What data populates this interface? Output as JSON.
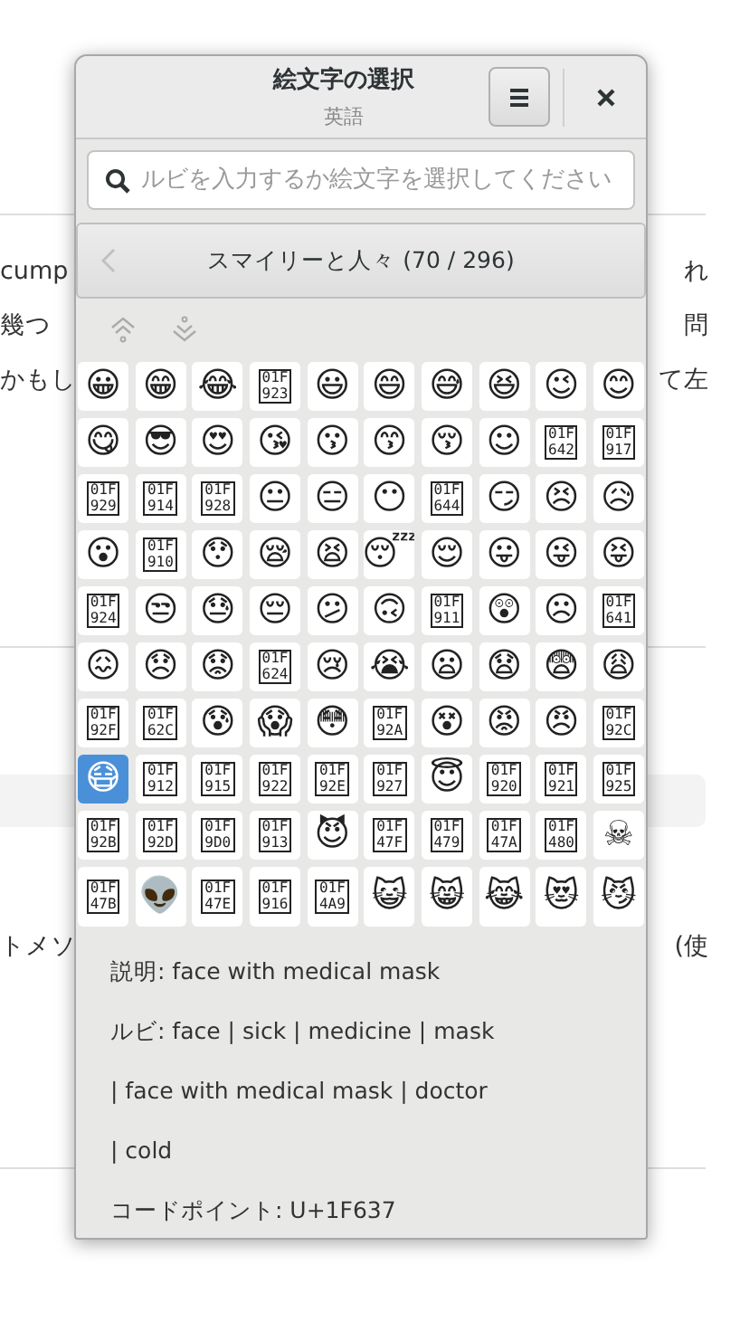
{
  "background_text": {
    "rows_top": [
      {
        "left": "cump",
        "right": "れ"
      },
      {
        "left": "幾つ",
        "right": "問"
      },
      {
        "left": "かもし",
        "right": "て左"
      }
    ],
    "rows_bottom": [
      {
        "left": "トメソ",
        "right": "(使"
      }
    ]
  },
  "window": {
    "title": "絵文字の選択",
    "subtitle": "英語"
  },
  "search": {
    "placeholder": "ルビを入力するか絵文字を選択してください"
  },
  "category": {
    "label": "スマイリーと人々 (70 / 296)",
    "back_disabled": true
  },
  "emojis": [
    {
      "kind": "glyph",
      "text": "😀",
      "selected": false
    },
    {
      "kind": "glyph",
      "text": "😁",
      "selected": false
    },
    {
      "kind": "glyph",
      "text": "😂",
      "selected": false
    },
    {
      "kind": "missing",
      "text": "01F\n923",
      "selected": false
    },
    {
      "kind": "glyph",
      "text": "😃",
      "selected": false
    },
    {
      "kind": "glyph",
      "text": "😄",
      "selected": false
    },
    {
      "kind": "glyph",
      "text": "😅",
      "selected": false
    },
    {
      "kind": "glyph",
      "text": "😆",
      "selected": false
    },
    {
      "kind": "glyph",
      "text": "😉",
      "selected": false
    },
    {
      "kind": "glyph",
      "text": "😊",
      "selected": false
    },
    {
      "kind": "glyph",
      "text": "😋",
      "selected": false
    },
    {
      "kind": "glyph",
      "text": "😎",
      "selected": false
    },
    {
      "kind": "glyph",
      "text": "😍",
      "selected": false
    },
    {
      "kind": "glyph",
      "text": "😘",
      "selected": false
    },
    {
      "kind": "glyph",
      "text": "😗",
      "selected": false
    },
    {
      "kind": "glyph",
      "text": "😙",
      "selected": false
    },
    {
      "kind": "glyph",
      "text": "😚",
      "selected": false
    },
    {
      "kind": "glyph",
      "text": "☺",
      "selected": false
    },
    {
      "kind": "missing",
      "text": "01F\n642",
      "selected": false
    },
    {
      "kind": "missing",
      "text": "01F\n917",
      "selected": false
    },
    {
      "kind": "missing",
      "text": "01F\n929",
      "selected": false
    },
    {
      "kind": "missing",
      "text": "01F\n914",
      "selected": false
    },
    {
      "kind": "missing",
      "text": "01F\n928",
      "selected": false
    },
    {
      "kind": "glyph",
      "text": "😐",
      "selected": false
    },
    {
      "kind": "glyph",
      "text": "😑",
      "selected": false
    },
    {
      "kind": "glyph",
      "text": "😶",
      "selected": false
    },
    {
      "kind": "missing",
      "text": "01F\n644",
      "selected": false
    },
    {
      "kind": "glyph",
      "text": "😏",
      "selected": false
    },
    {
      "kind": "glyph",
      "text": "😣",
      "selected": false
    },
    {
      "kind": "glyph",
      "text": "😥",
      "selected": false
    },
    {
      "kind": "glyph",
      "text": "😮",
      "selected": false
    },
    {
      "kind": "missing",
      "text": "01F\n910",
      "selected": false
    },
    {
      "kind": "glyph",
      "text": "😯",
      "selected": false
    },
    {
      "kind": "glyph",
      "text": "😪",
      "selected": false
    },
    {
      "kind": "glyph",
      "text": "😫",
      "selected": false
    },
    {
      "kind": "glyph",
      "text": "😴",
      "selected": false
    },
    {
      "kind": "glyph",
      "text": "😌",
      "selected": false
    },
    {
      "kind": "glyph",
      "text": "😛",
      "selected": false
    },
    {
      "kind": "glyph",
      "text": "😜",
      "selected": false
    },
    {
      "kind": "glyph",
      "text": "😝",
      "selected": false
    },
    {
      "kind": "missing",
      "text": "01F\n924",
      "selected": false
    },
    {
      "kind": "glyph",
      "text": "😒",
      "selected": false
    },
    {
      "kind": "glyph",
      "text": "😓",
      "selected": false
    },
    {
      "kind": "glyph",
      "text": "😔",
      "selected": false
    },
    {
      "kind": "glyph",
      "text": "😕",
      "selected": false
    },
    {
      "kind": "glyph",
      "text": "🙃",
      "selected": false
    },
    {
      "kind": "missing",
      "text": "01F\n911",
      "selected": false
    },
    {
      "kind": "glyph",
      "text": "😲",
      "selected": false
    },
    {
      "kind": "glyph",
      "text": "☹",
      "selected": false
    },
    {
      "kind": "missing",
      "text": "01F\n641",
      "selected": false
    },
    {
      "kind": "glyph",
      "text": "😖",
      "selected": false
    },
    {
      "kind": "glyph",
      "text": "😞",
      "selected": false
    },
    {
      "kind": "glyph",
      "text": "😟",
      "selected": false
    },
    {
      "kind": "missing",
      "text": "01F\n624",
      "selected": false
    },
    {
      "kind": "glyph",
      "text": "😢",
      "selected": false
    },
    {
      "kind": "glyph",
      "text": "😭",
      "selected": false
    },
    {
      "kind": "glyph",
      "text": "😦",
      "selected": false
    },
    {
      "kind": "glyph",
      "text": "😧",
      "selected": false
    },
    {
      "kind": "glyph",
      "text": "😨",
      "selected": false
    },
    {
      "kind": "glyph",
      "text": "😩",
      "selected": false
    },
    {
      "kind": "missing",
      "text": "01F\n92F",
      "selected": false
    },
    {
      "kind": "missing",
      "text": "01F\n62C",
      "selected": false
    },
    {
      "kind": "glyph",
      "text": "😰",
      "selected": false
    },
    {
      "kind": "glyph",
      "text": "😱",
      "selected": false
    },
    {
      "kind": "glyph",
      "text": "😳",
      "selected": false
    },
    {
      "kind": "missing",
      "text": "01F\n92A",
      "selected": false
    },
    {
      "kind": "glyph",
      "text": "😵",
      "selected": false
    },
    {
      "kind": "glyph",
      "text": "😡",
      "selected": false
    },
    {
      "kind": "glyph",
      "text": "😠",
      "selected": false
    },
    {
      "kind": "missing",
      "text": "01F\n92C",
      "selected": false
    },
    {
      "kind": "glyph",
      "text": "😷",
      "selected": true
    },
    {
      "kind": "missing",
      "text": "01F\n912",
      "selected": false
    },
    {
      "kind": "missing",
      "text": "01F\n915",
      "selected": false
    },
    {
      "kind": "missing",
      "text": "01F\n922",
      "selected": false
    },
    {
      "kind": "missing",
      "text": "01F\n92E",
      "selected": false
    },
    {
      "kind": "missing",
      "text": "01F\n927",
      "selected": false
    },
    {
      "kind": "glyph",
      "text": "😇",
      "selected": false
    },
    {
      "kind": "missing",
      "text": "01F\n920",
      "selected": false
    },
    {
      "kind": "missing",
      "text": "01F\n921",
      "selected": false
    },
    {
      "kind": "missing",
      "text": "01F\n925",
      "selected": false
    },
    {
      "kind": "missing",
      "text": "01F\n92B",
      "selected": false
    },
    {
      "kind": "missing",
      "text": "01F\n92D",
      "selected": false
    },
    {
      "kind": "missing",
      "text": "01F\n9D0",
      "selected": false
    },
    {
      "kind": "missing",
      "text": "01F\n913",
      "selected": false
    },
    {
      "kind": "glyph",
      "text": "😈",
      "selected": false
    },
    {
      "kind": "missing",
      "text": "01F\n47F",
      "selected": false
    },
    {
      "kind": "missing",
      "text": "01F\n479",
      "selected": false
    },
    {
      "kind": "missing",
      "text": "01F\n47A",
      "selected": false
    },
    {
      "kind": "missing",
      "text": "01F\n480",
      "selected": false
    },
    {
      "kind": "glyph",
      "text": "☠",
      "selected": false
    },
    {
      "kind": "missing",
      "text": "01F\n47B",
      "selected": false
    },
    {
      "kind": "glyph",
      "text": "👽",
      "selected": false
    },
    {
      "kind": "missing",
      "text": "01F\n47E",
      "selected": false
    },
    {
      "kind": "missing",
      "text": "01F\n916",
      "selected": false
    },
    {
      "kind": "missing",
      "text": "01F\n4A9",
      "selected": false
    },
    {
      "kind": "glyph",
      "text": "😺",
      "selected": false
    },
    {
      "kind": "glyph",
      "text": "😸",
      "selected": false
    },
    {
      "kind": "glyph",
      "text": "😹",
      "selected": false
    },
    {
      "kind": "glyph",
      "text": "😻",
      "selected": false
    },
    {
      "kind": "glyph",
      "text": "😼",
      "selected": false
    }
  ],
  "details": [
    "説明: face with medical mask",
    "ルビ: face | sick | medicine | mask",
    "| face with medical mask | doctor",
    "| cold",
    "コードポイント: U+1F637"
  ]
}
